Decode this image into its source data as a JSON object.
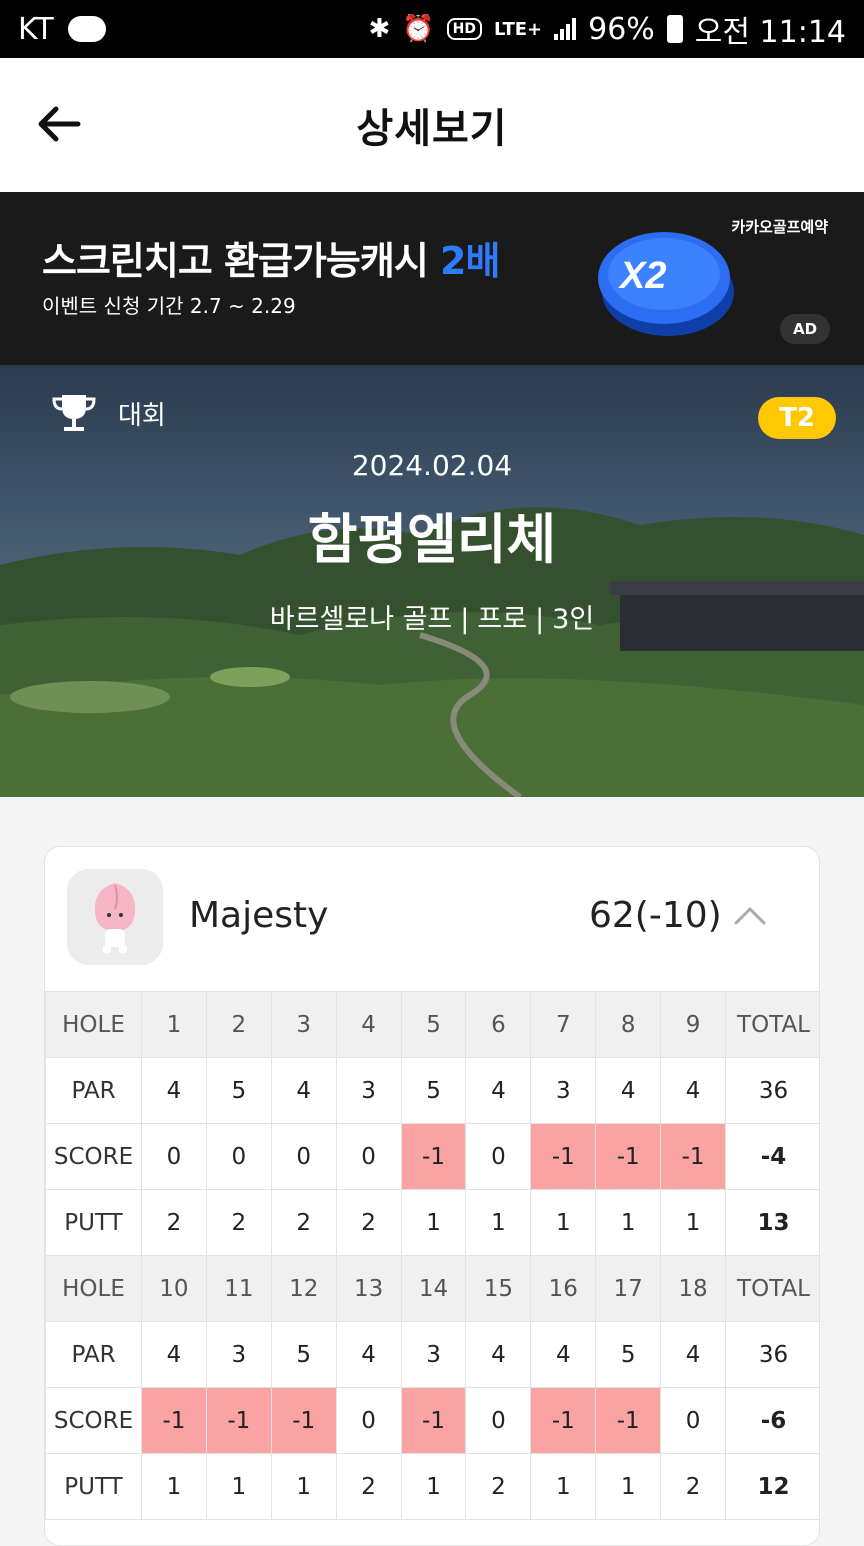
{
  "statusbar": {
    "carrier": "KT",
    "network": "LTE+",
    "battery": "96%",
    "time": "오전 11:14"
  },
  "header": {
    "title": "상세보기"
  },
  "ad": {
    "title_main": "스크린치고 환급가능캐시 ",
    "title_highlight": "2배",
    "subtitle": "이벤트 신청 기간  2.7 ~ 2.29",
    "coin_text": "X2",
    "brand": "카카오골프예약",
    "badge": "AD"
  },
  "hero": {
    "type_label": "대회",
    "rank_badge": "T2",
    "date": "2024.02.04",
    "course_name": "함평엘리체",
    "venue": "바르셀로나 골프",
    "mode": "프로",
    "players": "3인"
  },
  "player": {
    "name": "Majesty",
    "score": "62(-10)"
  },
  "scorecard": {
    "front": {
      "hole": [
        "HOLE",
        "1",
        "2",
        "3",
        "4",
        "5",
        "6",
        "7",
        "8",
        "9",
        "TOTAL"
      ],
      "par": [
        "PAR",
        "4",
        "5",
        "4",
        "3",
        "5",
        "4",
        "3",
        "4",
        "4",
        "36"
      ],
      "score": [
        "SCORE",
        "0",
        "0",
        "0",
        "0",
        "-1",
        "0",
        "-1",
        "-1",
        "-1",
        "-4"
      ],
      "putt": [
        "PUTT",
        "2",
        "2",
        "2",
        "2",
        "1",
        "1",
        "1",
        "1",
        "1",
        "13"
      ]
    },
    "back": {
      "hole": [
        "HOLE",
        "10",
        "11",
        "12",
        "13",
        "14",
        "15",
        "16",
        "17",
        "18",
        "TOTAL"
      ],
      "par": [
        "PAR",
        "4",
        "3",
        "5",
        "4",
        "3",
        "4",
        "4",
        "5",
        "4",
        "36"
      ],
      "score": [
        "SCORE",
        "-1",
        "-1",
        "-1",
        "0",
        "-1",
        "0",
        "-1",
        "-1",
        "0",
        "-6"
      ],
      "putt": [
        "PUTT",
        "1",
        "1",
        "1",
        "2",
        "1",
        "2",
        "1",
        "1",
        "2",
        "12"
      ]
    }
  },
  "colors": {
    "under_par_highlight": "#f9a3a3",
    "rank_badge": "#ffc800",
    "ad_highlight": "#2f7bff"
  },
  "icons": {
    "back": "arrow-left-icon",
    "trophy": "trophy-icon",
    "collapse": "chevron-up-icon"
  }
}
